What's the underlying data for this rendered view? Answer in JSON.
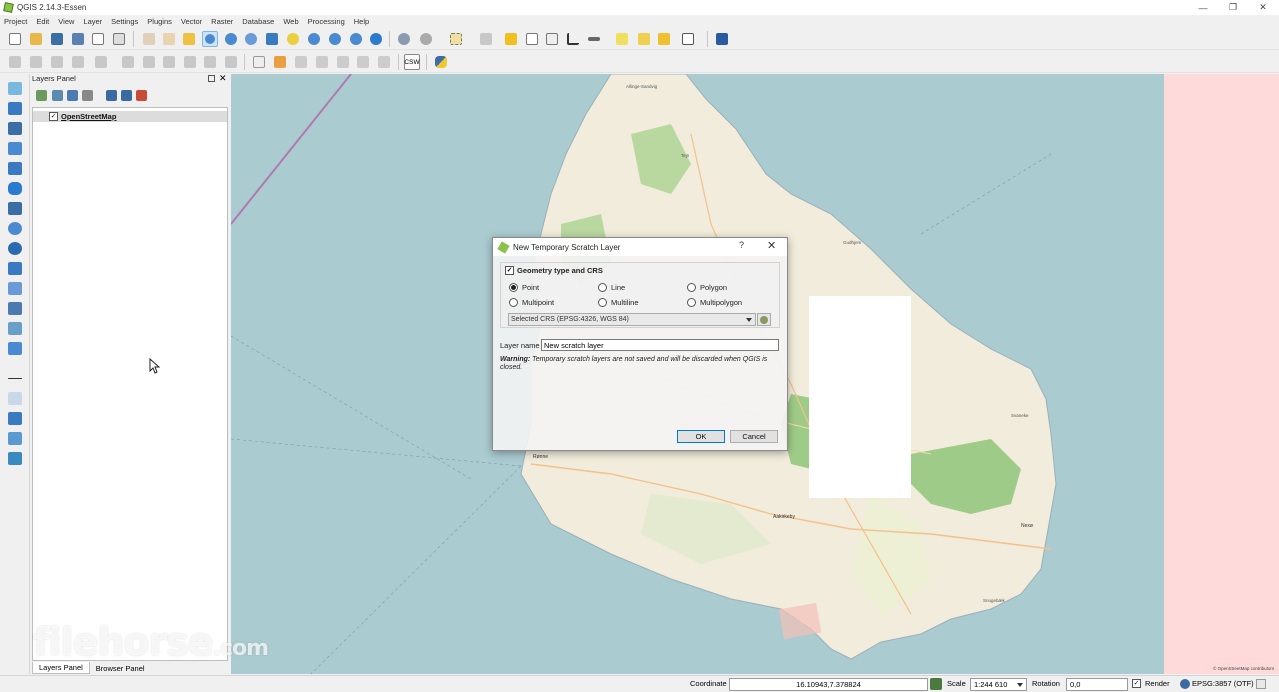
{
  "window": {
    "title": "QGIS 2.14.3-Essen",
    "controls": [
      "—",
      "❐",
      "✕"
    ]
  },
  "menu": [
    "Project",
    "Edit",
    "View",
    "Layer",
    "Settings",
    "Plugins",
    "Vector",
    "Raster",
    "Database",
    "Web",
    "Processing",
    "Help"
  ],
  "toolbar": {
    "csw_label": "CSW"
  },
  "layers_panel": {
    "title": "Layers Panel",
    "layers": [
      {
        "name": "OpenStreetMap",
        "checked": true
      }
    ],
    "tabs": [
      "Layers Panel",
      "Browser Panel"
    ]
  },
  "map": {
    "places": [
      "Allinge-Sandvig",
      "Tejn",
      "Rønne",
      "Nexø",
      "Aakirkeby",
      "Snogebæk",
      "Gudhjem",
      "Svaneke"
    ],
    "attribution": "© OpenStreetMap contributors",
    "colors": {
      "sea": "#aacbd0",
      "land": "#f1ecdc",
      "forest": "#9fcb88",
      "farmland": "#eef0d5",
      "outside": "#ffdada"
    }
  },
  "dialog": {
    "title": "New Temporary Scratch Layer",
    "help": "?",
    "close": "✕",
    "group_title": "Geometry type and CRS",
    "group_checked": true,
    "geometry_types": [
      {
        "label": "Point",
        "selected": true
      },
      {
        "label": "Line",
        "selected": false
      },
      {
        "label": "Polygon",
        "selected": false
      },
      {
        "label": "Multipoint",
        "selected": false
      },
      {
        "label": "Multiline",
        "selected": false
      },
      {
        "label": "Multipolygon",
        "selected": false
      }
    ],
    "crs": "Selected CRS (EPSG:4326, WGS 84)",
    "layer_name_label": "Layer name",
    "layer_name_value": "New scratch layer",
    "warning_bold": "Warning:",
    "warning_text": " Temporary scratch layers are not saved and will be discarded when QGIS is closed.",
    "ok": "OK",
    "cancel": "Cancel"
  },
  "statusbar": {
    "coordinate_label": "Coordinate",
    "coordinate_value": "16.10943,7.378824",
    "scale_label": "Scale",
    "scale_value": "1:244 610",
    "rotation_label": "Rotation",
    "rotation_value": "0,0",
    "render_label": "Render",
    "render_checked": true,
    "crs_label": "EPSG:3857 (OTF)"
  },
  "watermark": {
    "main": "filehorse",
    "suffix": ".com"
  }
}
